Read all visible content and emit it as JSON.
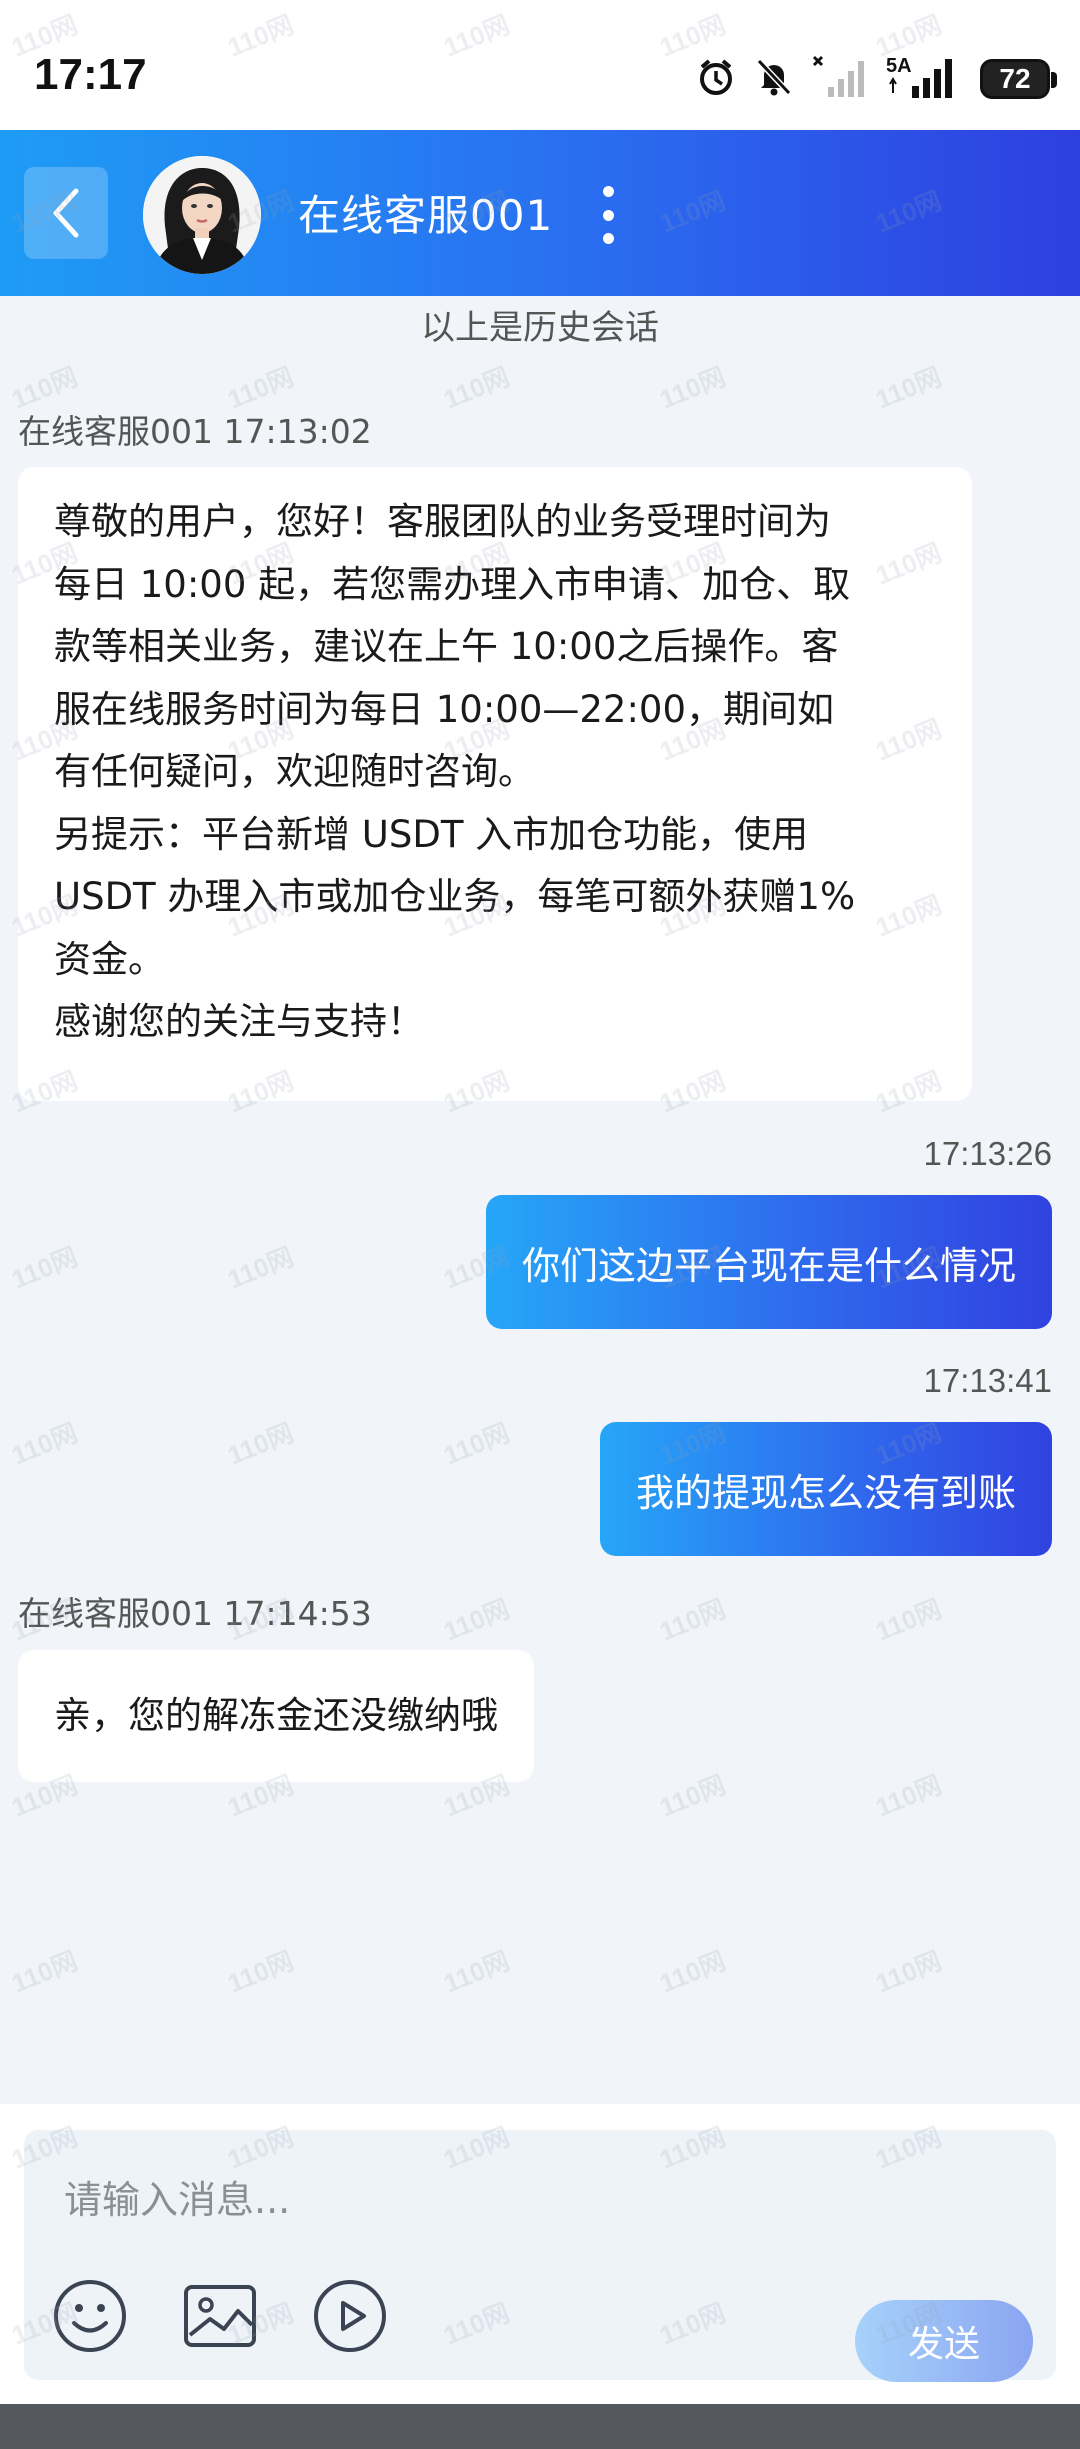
{
  "status_bar": {
    "time": "17:17",
    "network_label": "5A",
    "battery": "72"
  },
  "header": {
    "title": "在线客服001"
  },
  "chat": {
    "history_note": "以上是历史会话",
    "messages": [
      {
        "direction": "incoming",
        "sender_line": "在线客服001 17:13:02",
        "lines": [
          "尊敬的用户，您好！客服团队的业务受理时间为",
          "每日 10:00 起，若您需办理入市申请、加仓、取",
          "款等相关业务，建议在上午 10:00之后操作。客",
          "服在线服务时间为每日 10:00—22:00，期间如",
          "有任何疑问，欢迎随时咨询。",
          "另提示：平台新增 USDT 入市加仓功能，使用",
          "USDT 办理入市或加仓业务，每笔可额外获赠1%",
          "资金。",
          "感谢您的关注与支持！"
        ]
      },
      {
        "direction": "outgoing",
        "time": "17:13:26",
        "text": "你们这边平台现在是什么情况"
      },
      {
        "direction": "outgoing",
        "time": "17:13:41",
        "text": "我的提现怎么没有到账"
      },
      {
        "direction": "incoming",
        "sender_line": "在线客服001 17:14:53",
        "text": "亲，您的解冻金还没缴纳哦"
      }
    ]
  },
  "composer": {
    "placeholder": "请输入消息...",
    "send_label": "发送"
  },
  "watermark": "110网",
  "colors": {
    "header_gradient_start": "#1e9cf5",
    "header_gradient_end": "#2e3fe0",
    "chat_background": "#f1f5f9",
    "send_button": "#a7d2fb"
  }
}
